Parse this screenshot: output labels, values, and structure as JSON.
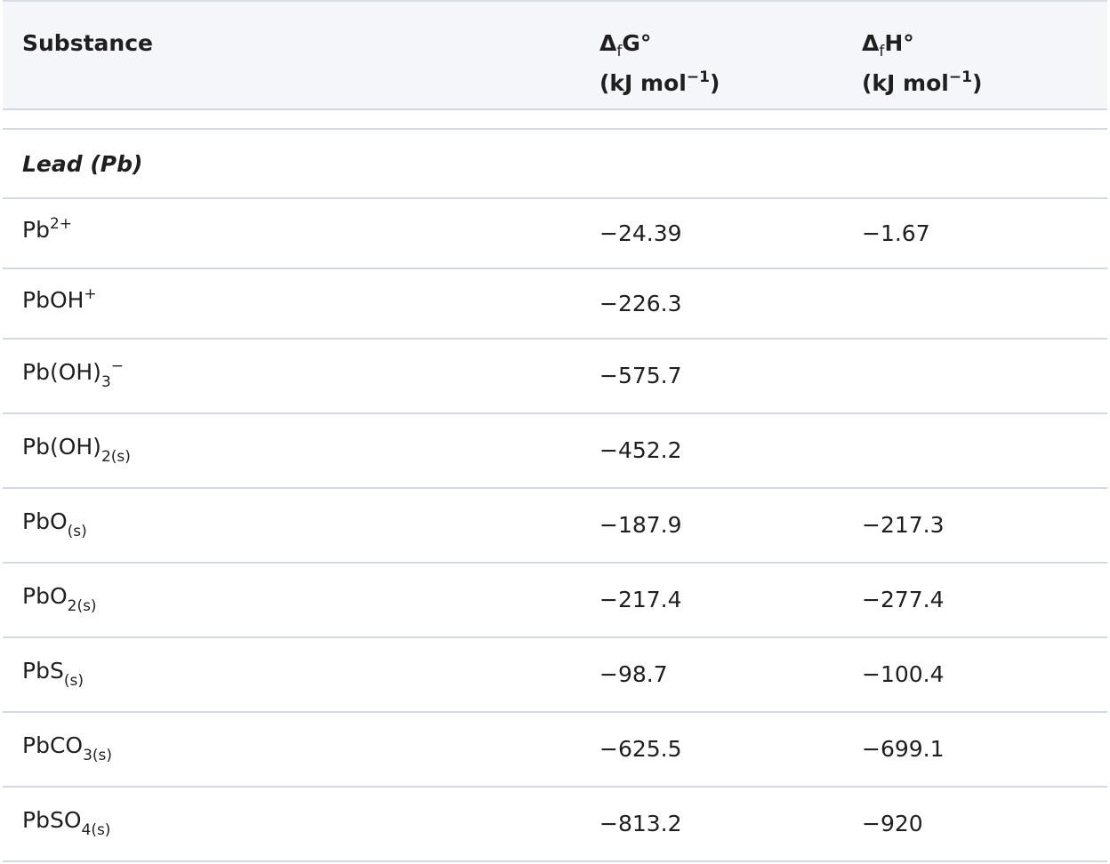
{
  "headers": {
    "substance": "Substance",
    "dg_symbol": "Δ",
    "dg_sub": "f",
    "dg_rest": "G°",
    "dg_unit_pre": "(kJ mol",
    "dg_unit_sup": "−1",
    "dg_unit_post": ")",
    "dh_symbol": "Δ",
    "dh_sub": "f",
    "dh_rest": "H°",
    "dh_unit_pre": "(kJ mol",
    "dh_unit_sup": "−1",
    "dh_unit_post": ")"
  },
  "group": {
    "label": "Lead (Pb)"
  },
  "rows": [
    {
      "base": "Pb",
      "sup": "2+",
      "sub": "",
      "dg": "−24.39",
      "dh": "−1.67"
    },
    {
      "base": "PbOH",
      "sup": "+",
      "sub": "",
      "dg": "−226.3",
      "dh": ""
    },
    {
      "base": "Pb(OH)",
      "sup": "−",
      "sub": "3",
      "dg": "−575.7",
      "dh": ""
    },
    {
      "base": "Pb(OH)",
      "sup": "",
      "sub": "2(s)",
      "dg": "−452.2",
      "dh": ""
    },
    {
      "base": "PbO",
      "sup": "",
      "sub": "(s)",
      "dg": "−187.9",
      "dh": "−217.3"
    },
    {
      "base": "PbO",
      "sup": "",
      "sub": "2(s)",
      "dg": "−217.4",
      "dh": "−277.4"
    },
    {
      "base": "PbS",
      "sup": "",
      "sub": "(s)",
      "dg": "−98.7",
      "dh": "−100.4"
    },
    {
      "base": "PbCO",
      "sup": "",
      "sub": "3(s)",
      "dg": "−625.5",
      "dh": "−699.1"
    },
    {
      "base": "PbSO",
      "sup": "",
      "sub": "4(s)",
      "dg": "−813.2",
      "dh": "−920"
    }
  ]
}
